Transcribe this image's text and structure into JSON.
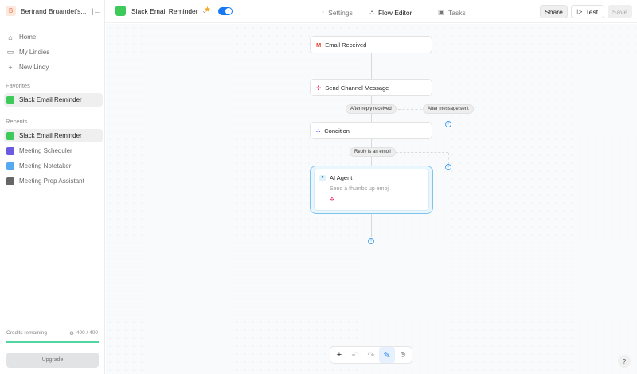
{
  "workspace": {
    "initial": "B",
    "name": "Bertrand Bruandet's..."
  },
  "nav": [
    {
      "label": "Home",
      "icon": "home-icon"
    },
    {
      "label": "My Lindies",
      "icon": "folder-icon"
    },
    {
      "label": "New Lindy",
      "icon": "plus-icon"
    }
  ],
  "favorites": {
    "title": "Favorites",
    "items": [
      {
        "label": "Slack Email Reminder",
        "color": "#3ec95b"
      }
    ]
  },
  "recents": {
    "title": "Recents",
    "items": [
      {
        "label": "Slack Email Reminder",
        "color": "#3ec95b"
      },
      {
        "label": "Meeting Scheduler",
        "color": "#6a5be0"
      },
      {
        "label": "Meeting Notetaker",
        "color": "#55a9f0"
      },
      {
        "label": "Meeting Prep Assistant",
        "color": "#666666"
      }
    ]
  },
  "credits": {
    "label": "Credits remaining",
    "value": "400 / 400",
    "fraction": 1.0
  },
  "upgrade": "Upgrade",
  "header": {
    "title": "Slack Email Reminder",
    "enabled": true,
    "tabs": [
      {
        "label": "Settings"
      },
      {
        "label": "Flow Editor"
      },
      {
        "label": "Tasks"
      }
    ],
    "share": "Share",
    "test": "Test",
    "save": "Save"
  },
  "flow": {
    "email": "Email Received",
    "send": "Send Channel Message",
    "branch1": "After reply received",
    "branch2": "After message sent",
    "condition": "Condition",
    "cond_branch": "Reply is an emoji",
    "agent": {
      "title": "AI Agent",
      "desc": "Send a thumbs up emoji"
    }
  },
  "help": "?"
}
